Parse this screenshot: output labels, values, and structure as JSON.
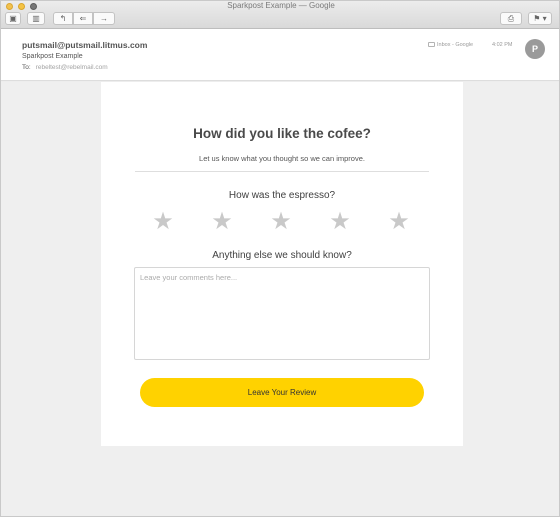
{
  "window": {
    "title": "Sparkpost Example — Google"
  },
  "toolbar": {
    "buttons": [
      {
        "icon": "archive-icon",
        "glyph": "▣"
      },
      {
        "icon": "trash-icon",
        "glyph": "▥"
      },
      {
        "icon": "reply-icon",
        "glyph": "↰"
      },
      {
        "icon": "reply-all-icon",
        "glyph": "⇐"
      },
      {
        "icon": "forward-icon",
        "glyph": "→"
      },
      {
        "icon": "print-icon",
        "glyph": "⎙"
      },
      {
        "icon": "flag-icon",
        "glyph": "⚑ ▾"
      }
    ]
  },
  "email": {
    "from": "putsmail@putsmail.litmus.com",
    "subject": "Sparkpost Example",
    "to_label": "To:",
    "to_address": "rebeltest@rebelmail.com",
    "mailbox": "Inbox - Google",
    "time": "4:02 PM",
    "avatar_initial": "P"
  },
  "form": {
    "heading": "How did you like the cofee?",
    "subheading": "Let us know what you thought so we can improve.",
    "question_rating": "How was the espresso?",
    "star_glyph": "★",
    "rating_max": 5,
    "rating_value": 0,
    "question_comments": "Anything else we should know?",
    "comments_placeholder": "Leave your comments here...",
    "submit_label": "Leave Your Review"
  },
  "colors": {
    "accent": "#ffd200",
    "star_empty": "#c9c9c9"
  }
}
